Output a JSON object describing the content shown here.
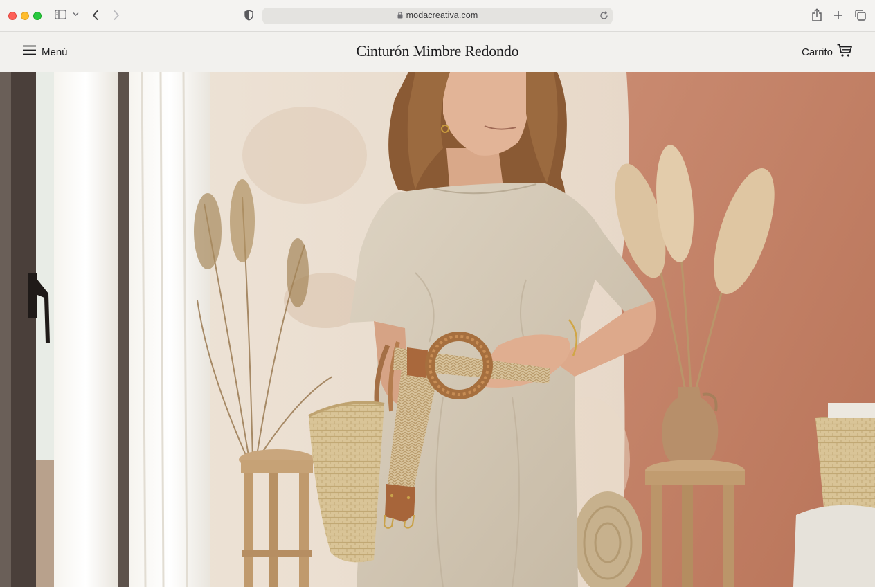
{
  "browser": {
    "url": "modacreativa.com",
    "icons": [
      "sidebar-icon",
      "chevron-down-icon",
      "back-icon",
      "forward-icon",
      "shield-icon",
      "lock-icon",
      "reload-icon",
      "share-icon",
      "plus-icon",
      "tabs-icon"
    ]
  },
  "header": {
    "menu_label": "Menú",
    "title": "Cinturón Mimbre Redondo",
    "cart_label": "Carrito"
  },
  "hero": {
    "alt": "Model in linen dress wearing a round wicker belt, holding a straw basket bag"
  },
  "colors": {
    "header_bg": "#f2f1ee",
    "chrome_bg": "#f4f3f1",
    "terracotta_wall": "#c98a6e",
    "linen_dress": "#d6cbb8",
    "wicker_belt": "#b27a4a"
  }
}
